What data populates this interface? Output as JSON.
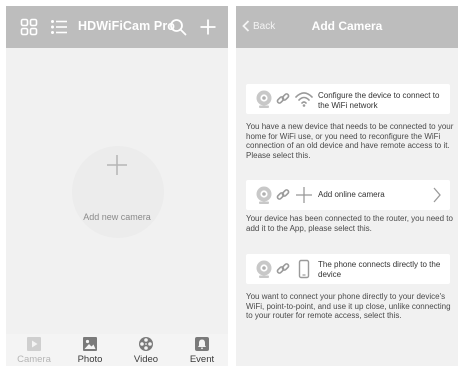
{
  "left_screen": {
    "title": "HDWiFiCam Pro",
    "empty_state_label": "Add new camera",
    "bottom_nav": [
      {
        "label": "Camera",
        "icon": "play-icon",
        "active": true
      },
      {
        "label": "Photo",
        "icon": "photo-icon",
        "active": false
      },
      {
        "label": "Video",
        "icon": "film-reel-icon",
        "active": false
      },
      {
        "label": "Event",
        "icon": "bell-icon",
        "active": false
      }
    ]
  },
  "right_screen": {
    "back_label": "Back",
    "title": "Add Camera",
    "options": [
      {
        "title": "Configure the device to connect to the WiFi network",
        "description": "You have a new device that needs to be connected to your home for WiFi use, or you need to reconfigure the WiFi connection of an old device and have remote access to it. Please select this."
      },
      {
        "title": "Add online camera",
        "description": "Your device has been connected to the router, you need to add it to the App, please select this."
      },
      {
        "title": "The phone connects directly to the device",
        "description": "You want to connect your phone directly to your device's WiFi, point-to-point, and use it up close, unlike connecting to your router for remote access, select this."
      }
    ]
  },
  "colors": {
    "topbar": "#bdbdbd",
    "background": "#f1f1f1",
    "card": "#ffffff",
    "text": "#4a4a4a"
  }
}
